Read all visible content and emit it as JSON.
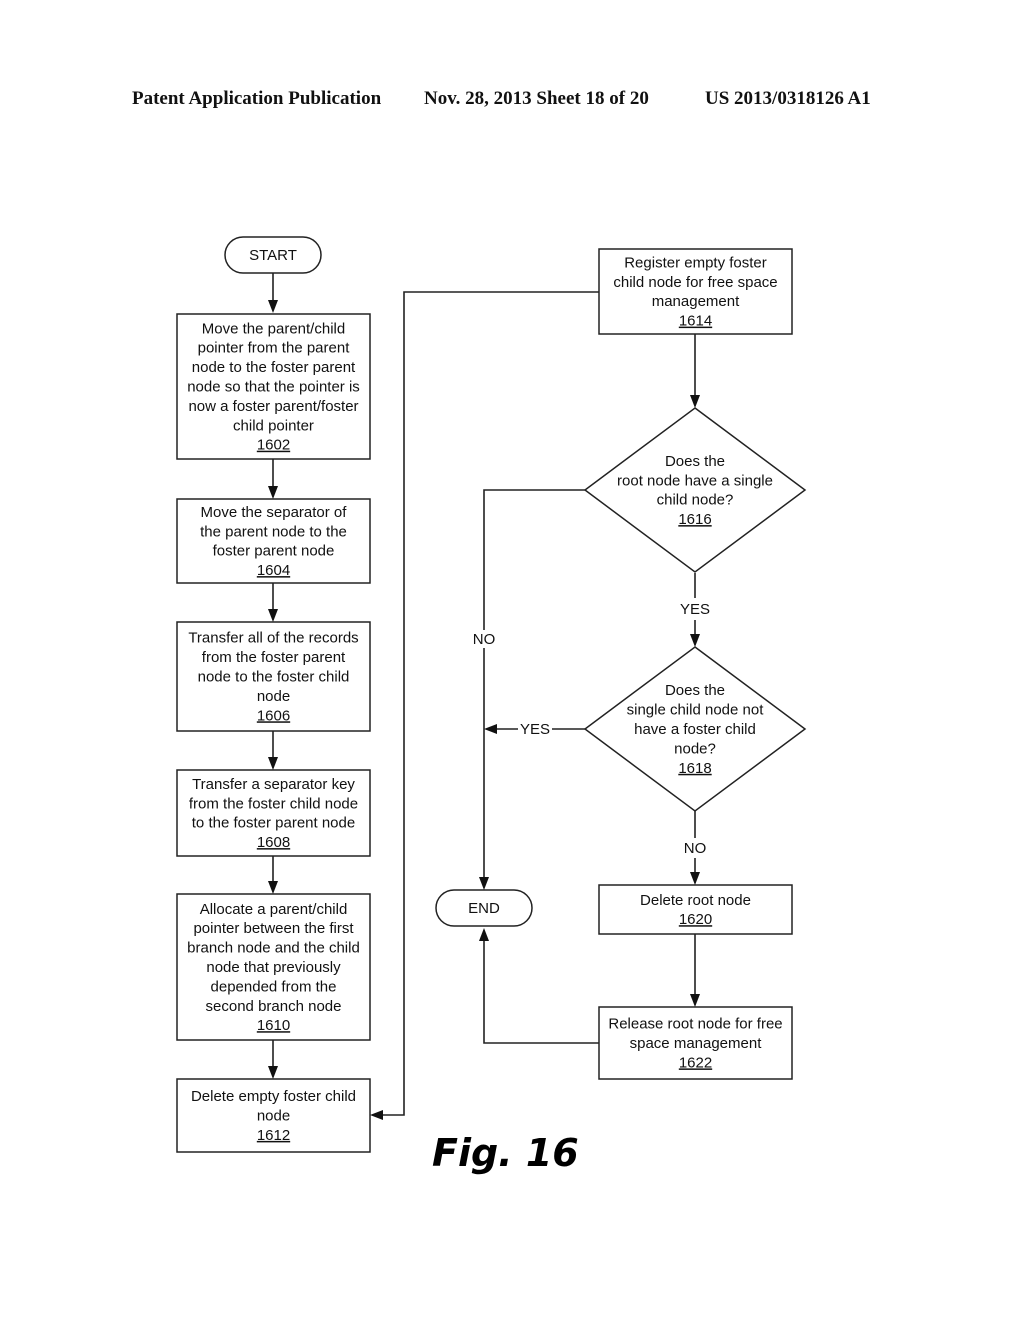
{
  "header": {
    "publication": "Patent Application Publication",
    "date_sheet": "Nov. 28, 2013   Sheet 18 of 20",
    "patent_number": "US 2013/0318126 A1"
  },
  "figure_label": "Fig. 16",
  "nodes": {
    "start": {
      "type": "terminal",
      "lines": [
        "START"
      ]
    },
    "n1602": {
      "type": "process",
      "lines": [
        "Move the parent/child",
        "pointer from the parent",
        "node to the foster parent",
        "node so that the pointer is",
        "now a foster parent/foster",
        "child pointer"
      ],
      "ref": "1602"
    },
    "n1604": {
      "type": "process",
      "lines": [
        "Move the separator  of",
        "the parent node to the",
        "foster parent node"
      ],
      "ref": "1604"
    },
    "n1606": {
      "type": "process",
      "lines": [
        "Transfer all of the records",
        "from the foster parent",
        "node to the foster child",
        "node"
      ],
      "ref": "1606"
    },
    "n1608": {
      "type": "process",
      "lines": [
        "Transfer a separator key",
        "from the foster child node",
        "to the foster parent node"
      ],
      "ref": "1608"
    },
    "n1610": {
      "type": "process",
      "lines": [
        "Allocate a parent/child",
        "pointer between the first",
        "branch node and the child",
        "node that previously",
        "depended from the",
        "second branch node"
      ],
      "ref": "1610"
    },
    "n1612": {
      "type": "process",
      "lines": [
        "Delete empty foster child",
        "node"
      ],
      "ref": "1612"
    },
    "n1614": {
      "type": "process",
      "lines": [
        "Register empty foster",
        "child node for free space",
        "management"
      ],
      "ref": "1614"
    },
    "n1616": {
      "type": "decision",
      "lines": [
        "Does the",
        "root node have a single",
        "child node?"
      ],
      "ref": "1616"
    },
    "n1618": {
      "type": "decision",
      "lines": [
        "Does the",
        "single child node not",
        "have a foster child",
        "node?"
      ],
      "ref": "1618"
    },
    "n1620": {
      "type": "process",
      "lines": [
        "Delete root node"
      ],
      "ref": "1620"
    },
    "n1622": {
      "type": "process",
      "lines": [
        "Release root node for free",
        "space management"
      ],
      "ref": "1622"
    },
    "end": {
      "type": "terminal",
      "lines": [
        "END"
      ]
    }
  },
  "edge_labels": {
    "e1616_yes": "YES",
    "e1616_no": "NO",
    "e1618_yes": "YES",
    "e1618_no": "NO"
  }
}
